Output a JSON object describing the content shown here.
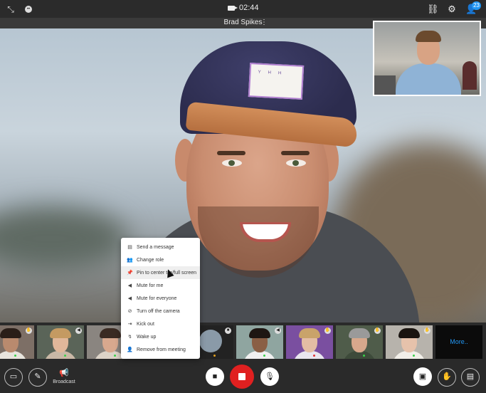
{
  "topbar": {
    "timer": "02:44",
    "participants_count": "23",
    "left_icons": [
      "minimize-icon",
      "emoji-icon"
    ],
    "right_icons": [
      "link-icon",
      "gear-icon",
      "participants-icon"
    ]
  },
  "speaker": {
    "name": "Brad Spikes"
  },
  "menu": {
    "items": [
      {
        "label": "Send a message",
        "icon": "message-icon"
      },
      {
        "label": "Change role",
        "icon": "people-icon"
      },
      {
        "label": "Pin to center tile/full screen",
        "icon": "pin-icon"
      },
      {
        "label": "Mute for me",
        "icon": "speaker-icon"
      },
      {
        "label": "Mute for everyone",
        "icon": "speaker-icon"
      },
      {
        "label": "Turn off the camera",
        "icon": "camera-off-icon"
      },
      {
        "label": "Kick out",
        "icon": "exit-icon"
      },
      {
        "label": "Wake up",
        "icon": "wake-icon"
      },
      {
        "label": "Remove from meeting",
        "icon": "remove-person-icon"
      }
    ]
  },
  "thumbnails": {
    "more_label": "More.."
  },
  "bottombar": {
    "broadcast_label": "Broadcast"
  },
  "colors": {
    "accent": "#2196f3",
    "record": "#e02020",
    "bar": "#2a2a2a"
  }
}
